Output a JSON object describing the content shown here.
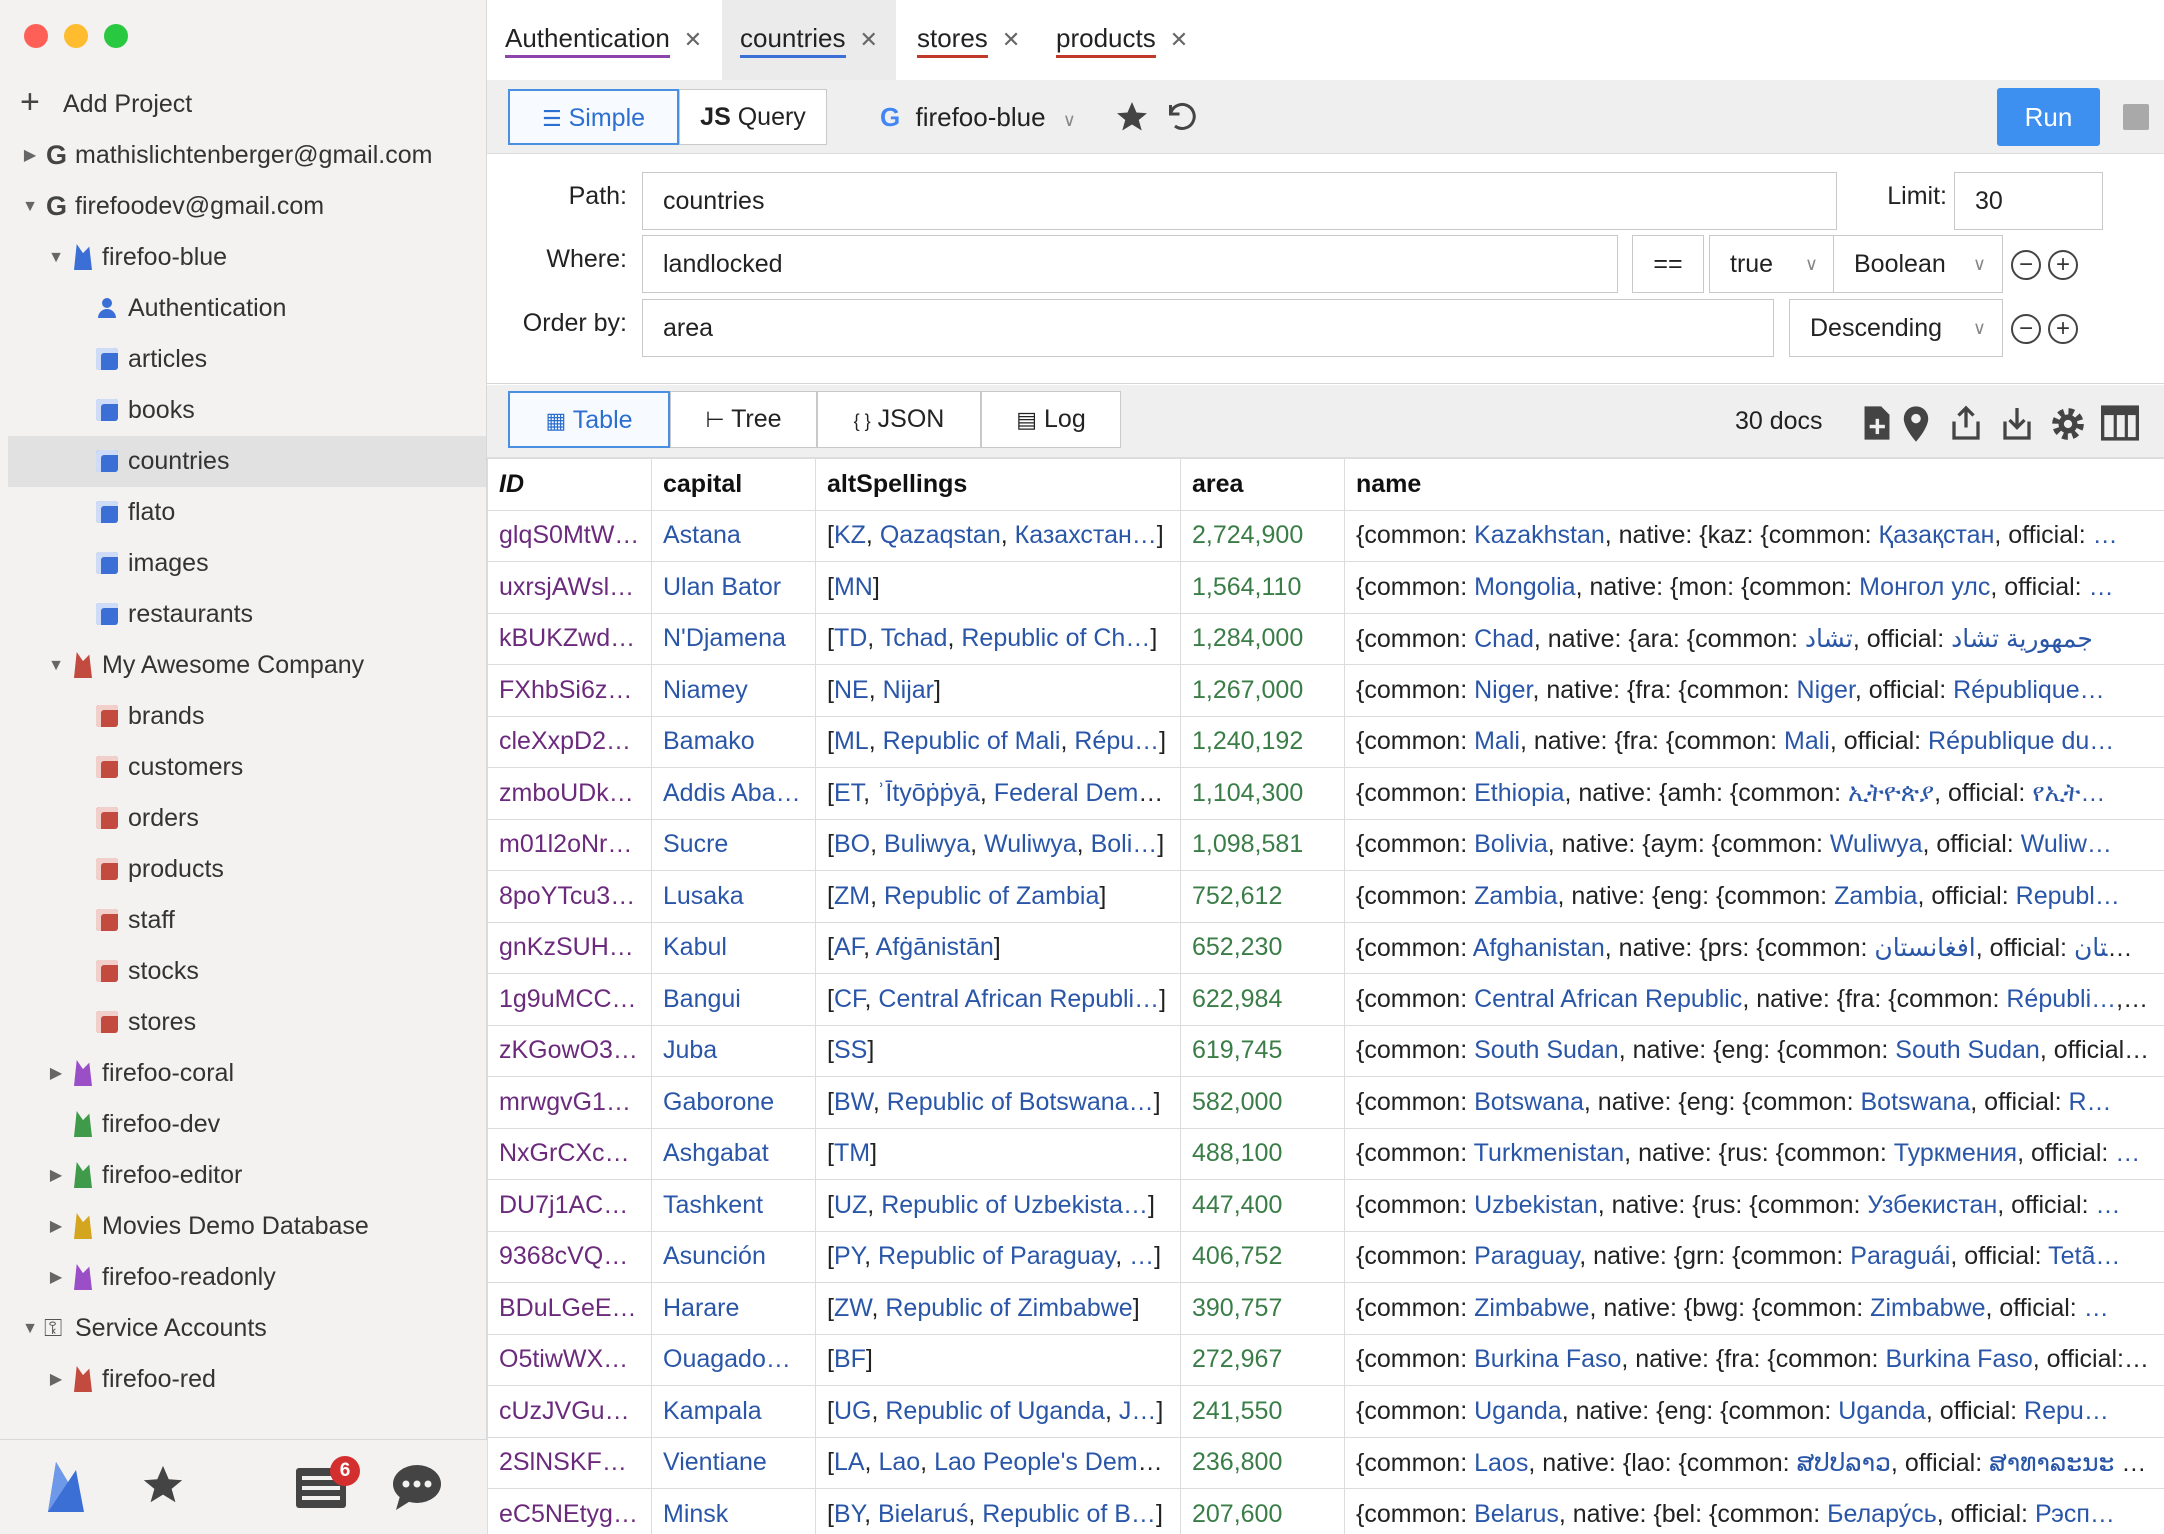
{
  "sidebar": {
    "add_project": "Add Project",
    "accounts": [
      {
        "label": "mathislichtenberger@gmail.com"
      },
      {
        "label": "firefoodev@gmail.com"
      }
    ],
    "projects": {
      "firefoo_blue": "firefoo-blue",
      "firefoo_blue_items": [
        "Authentication",
        "articles",
        "books",
        "countries",
        "flato",
        "images",
        "restaurants"
      ],
      "my_company": "My Awesome Company",
      "my_company_items": [
        "brands",
        "customers",
        "orders",
        "products",
        "staff",
        "stocks",
        "stores"
      ],
      "others": [
        "firefoo-coral",
        "firefoo-dev",
        "firefoo-editor",
        "Movies Demo Database",
        "firefoo-readonly"
      ]
    },
    "service_accounts": "Service Accounts",
    "service_items": [
      "firefoo-red"
    ],
    "selected": "countries",
    "notifications_badge": "6"
  },
  "tabs": [
    {
      "label": "Authentication",
      "underline": "#8e44ad"
    },
    {
      "label": "countries",
      "underline": "#3b6fd6"
    },
    {
      "label": "stores",
      "underline": "#c0392b"
    },
    {
      "label": "products",
      "underline": "#c0392b"
    }
  ],
  "toolbar": {
    "simple": "Simple",
    "query": "Query",
    "query_prefix": "JS",
    "project": "firefoo-blue",
    "run": "Run"
  },
  "query": {
    "path_label": "Path:",
    "path_value": "countries",
    "limit_label": "Limit:",
    "limit_value": "30",
    "where_label": "Where:",
    "where_field": "landlocked",
    "where_op": "==",
    "where_value": "true",
    "where_type": "Boolean",
    "order_label": "Order by:",
    "order_field": "area",
    "order_dir": "Descending"
  },
  "results": {
    "views": [
      "Table",
      "Tree",
      "JSON",
      "Log"
    ],
    "json_prefix": "{ }",
    "count": "30 docs"
  },
  "table": {
    "headers": [
      "ID",
      "capital",
      "altSpellings",
      "area",
      "name"
    ],
    "rows": [
      {
        "id": "glqS0MtW…",
        "capital": "Astana",
        "alt": [
          "KZ",
          "Qazaqstan",
          "Казахстан…"
        ],
        "area": "2,724,900",
        "common": "Kazakhstan",
        "lang": "kaz",
        "ncommon": "Қазақстан",
        "official": "…"
      },
      {
        "id": "uxrsjAWsl…",
        "capital": "Ulan Bator",
        "alt": [
          "MN"
        ],
        "area": "1,564,110",
        "common": "Mongolia",
        "lang": "mon",
        "ncommon": "Монгол улс",
        "official": "…"
      },
      {
        "id": "kBUKZwd…",
        "capital": "N'Djamena",
        "alt": [
          "TD",
          "Tchad",
          "Republic of Ch…"
        ],
        "area": "1,284,000",
        "common": "Chad",
        "lang": "ara",
        "ncommon": "تشاد",
        "official": "جمهورية تشاد"
      },
      {
        "id": "FXhbSi6z…",
        "capital": "Niamey",
        "alt": [
          "NE",
          "Nijar"
        ],
        "area": "1,267,000",
        "common": "Niger",
        "lang": "fra",
        "ncommon": "Niger",
        "official": "République…"
      },
      {
        "id": "cleXxpD2…",
        "capital": "Bamako",
        "alt": [
          "ML",
          "Republic of Mali",
          "Répu…"
        ],
        "area": "1,240,192",
        "common": "Mali",
        "lang": "fra",
        "ncommon": "Mali",
        "official": "République du…"
      },
      {
        "id": "zmboUDk…",
        "capital": "Addis Aba…",
        "alt": [
          "ET",
          "ʾĪtyōṗṗyā",
          "Federal Dem…"
        ],
        "area": "1,104,300",
        "common": "Ethiopia",
        "lang": "amh",
        "ncommon": "ኢትዮጵያ",
        "official": "የኢት…"
      },
      {
        "id": "m01l2oNr…",
        "capital": "Sucre",
        "alt": [
          "BO",
          "Buliwya",
          "Wuliwya",
          "Boli…"
        ],
        "area": "1,098,581",
        "common": "Bolivia",
        "lang": "aym",
        "ncommon": "Wuliwya",
        "official": "Wuliw…"
      },
      {
        "id": "8poYTcu3…",
        "capital": "Lusaka",
        "alt": [
          "ZM",
          "Republic of Zambia"
        ],
        "area": "752,612",
        "common": "Zambia",
        "lang": "eng",
        "ncommon": "Zambia",
        "official": "Republ…"
      },
      {
        "id": "gnKzSUH…",
        "capital": "Kabul",
        "alt": [
          "AF",
          "Afġānistān"
        ],
        "area": "652,230",
        "common": "Afghanistan",
        "lang": "prs",
        "ncommon": "افغانستان",
        "official": "افغانستان"
      },
      {
        "id": "1g9uMCC…",
        "capital": "Bangui",
        "alt": [
          "CF",
          "Central African Republi…"
        ],
        "area": "622,984",
        "common": "Central African Republic",
        "lang": "fra",
        "ncommon": "Républi…",
        "official": ""
      },
      {
        "id": "zKGowO3…",
        "capital": "Juba",
        "alt": [
          "SS"
        ],
        "area": "619,745",
        "common": "South Sudan",
        "lang": "eng",
        "ncommon": "South Sudan",
        "official": "…"
      },
      {
        "id": "mrwgvG1…",
        "capital": "Gaborone",
        "alt": [
          "BW",
          "Republic of Botswana…"
        ],
        "area": "582,000",
        "common": "Botswana",
        "lang": "eng",
        "ncommon": "Botswana",
        "official": "R…"
      },
      {
        "id": "NxGrCXcs…",
        "capital": "Ashgabat",
        "alt": [
          "TM"
        ],
        "area": "488,100",
        "common": "Turkmenistan",
        "lang": "rus",
        "ncommon": "Туркмения",
        "official": "…"
      },
      {
        "id": "DU7j1ACy…",
        "capital": "Tashkent",
        "alt": [
          "UZ",
          "Republic of Uzbekista…"
        ],
        "area": "447,400",
        "common": "Uzbekistan",
        "lang": "rus",
        "ncommon": "Узбекистан",
        "official": "…"
      },
      {
        "id": "9368cVQ…",
        "capital": "Asunción",
        "alt": [
          "PY",
          "Republic of Paraguay",
          "…"
        ],
        "area": "406,752",
        "common": "Paraguay",
        "lang": "grn",
        "ncommon": "Paraguái",
        "official": "Tetã…"
      },
      {
        "id": "BDuLGeE…",
        "capital": "Harare",
        "alt": [
          "ZW",
          "Republic of Zimbabwe"
        ],
        "area": "390,757",
        "common": "Zimbabwe",
        "lang": "bwg",
        "ncommon": "Zimbabwe",
        "official": "…"
      },
      {
        "id": "O5tiwWX…",
        "capital": "Ouagadou…",
        "alt": [
          "BF"
        ],
        "area": "272,967",
        "common": "Burkina Faso",
        "lang": "fra",
        "ncommon": "Burkina Faso",
        "official": "…"
      },
      {
        "id": "cUzJVGu…",
        "capital": "Kampala",
        "alt": [
          "UG",
          "Republic of Uganda",
          "J…"
        ],
        "area": "241,550",
        "common": "Uganda",
        "lang": "eng",
        "ncommon": "Uganda",
        "official": "Repu…"
      },
      {
        "id": "2SlNSKFY…",
        "capital": "Vientiane",
        "alt": [
          "LA",
          "Lao",
          "Lao People's Dem…"
        ],
        "area": "236,800",
        "common": "Laos",
        "lang": "lao",
        "ncommon": "ສປປລາວ",
        "official": "ສາທາລະນະ ຊ…"
      },
      {
        "id": "eC5NEtyg…",
        "capital": "Minsk",
        "alt": [
          "BY",
          "Bielaruś",
          "Republic of B…"
        ],
        "area": "207,600",
        "common": "Belarus",
        "lang": "bel",
        "ncommon": "Белару́сь",
        "official": "Рэсп…"
      }
    ]
  }
}
